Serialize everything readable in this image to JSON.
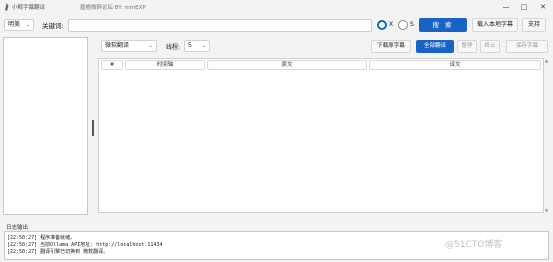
{
  "window": {
    "title": "小鲸字幕翻译",
    "subtitle": "屋檐微醉论坛 BY: mmEXP",
    "minimize": "—",
    "maximize": "□",
    "close": "✕"
  },
  "toolbar": {
    "language_value": "明美",
    "keyword_label": "关键词:",
    "keyword_value": "",
    "radio_x_label": "X",
    "radio_s_label": "S",
    "search_label": "搜 索",
    "load_local_label": "载入本地字幕",
    "support_label": "支持"
  },
  "subtitle_toolbar": {
    "engine_value": "微软翻译",
    "thread_label": "线程:",
    "thread_value": "5",
    "download_original_label": "下载原字幕",
    "translate_all_label": "全部翻译",
    "pause_label": "暂停",
    "stop_label": "终止",
    "save_label": "保存字幕"
  },
  "table": {
    "columns": [
      "#",
      "时间轴",
      "原文",
      "译文"
    ]
  },
  "log": {
    "label": "日志输出",
    "lines": [
      "[22:50:27] 程序准备就绪。",
      "[22:50:27] 当前Ollama API地址: http://localhost:11434",
      "[22:50:27] 翻译引擎已切换到 微软翻译。"
    ]
  },
  "watermark": "@51CTO博客",
  "colors": {
    "accent": "#1a63c6",
    "background": "#f3f3f3"
  }
}
